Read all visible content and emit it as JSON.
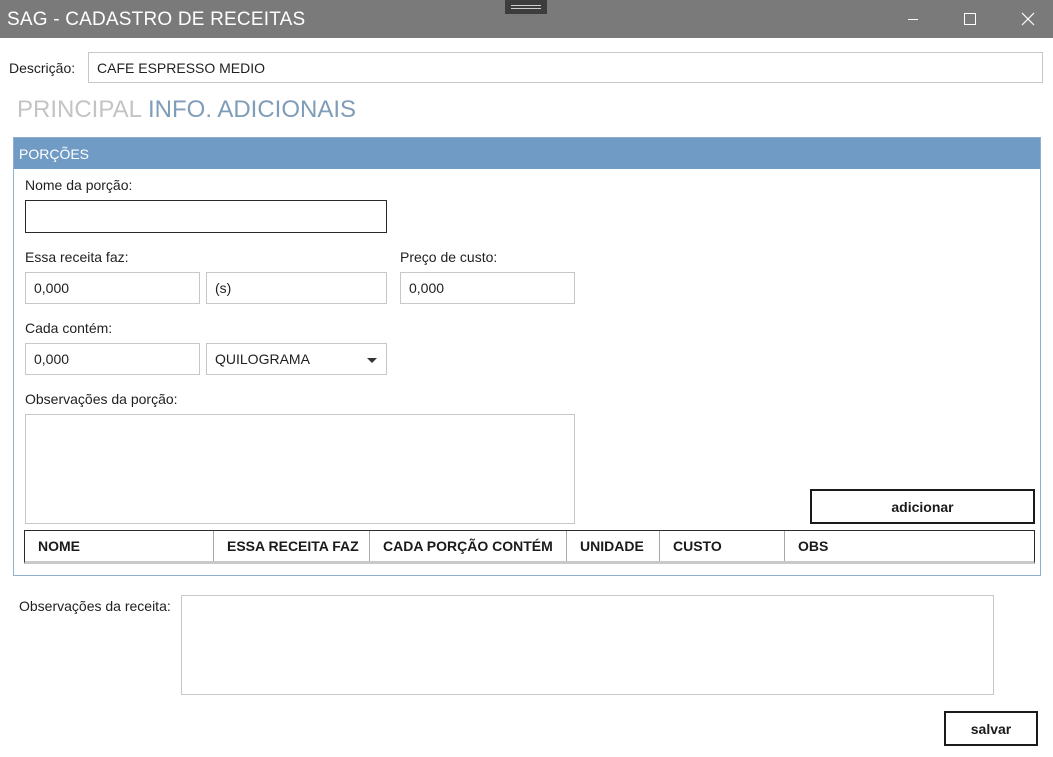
{
  "window": {
    "title": "SAG - CADASTRO DE RECEITAS"
  },
  "descricao": {
    "label": "Descrição:",
    "value": "CAFE ESPRESSO MEDIO"
  },
  "tabs": [
    {
      "label": "PRINCIPAL",
      "active": false
    },
    {
      "label": "INFO. ADICIONAIS",
      "active": true
    }
  ],
  "porcoes": {
    "header": "PORÇÕES",
    "nome_label": "Nome da porção:",
    "nome_value": "",
    "essa_receita_faz_label": "Essa receita faz:",
    "essa_receita_faz_value": "0,000",
    "essa_receita_faz_unit": "(s)",
    "preco_custo_label": "Preço de custo:",
    "preco_custo_value": "0,000",
    "cada_contem_label": "Cada  contém:",
    "cada_contem_value": "0,000",
    "cada_contem_unit": "QUILOGRAMA",
    "observacoes_label": "Observações da porção:",
    "observacoes_value": "",
    "adicionar_label": "adicionar",
    "columns": [
      "NOME",
      "ESSA RECEITA FAZ",
      "CADA PORÇÃO CONTÉM",
      "UNIDADE",
      "CUSTO",
      "OBS"
    ]
  },
  "receita": {
    "observacoes_label": "Observações da receita:",
    "observacoes_value": "",
    "salvar_label": "salvar"
  },
  "colors": {
    "titlebar": "#7a7a7a",
    "group_header": "#6f9bc4",
    "tab_active": "#7f9cb8",
    "tab_inactive": "#c4c4c4"
  }
}
